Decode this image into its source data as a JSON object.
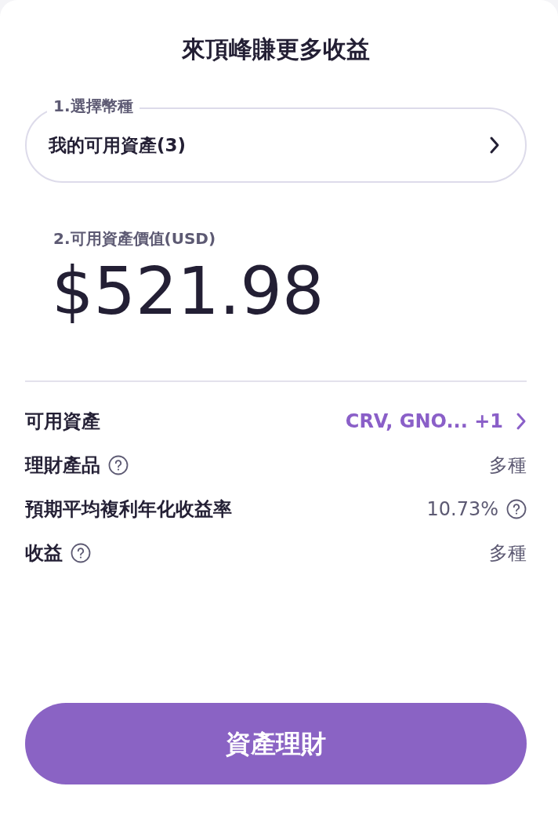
{
  "title": "來頂峰賺更多收益",
  "coin_select": {
    "legend": "1.選擇幣種",
    "value": "我的可用資產(3)"
  },
  "asset_value": {
    "label": "2.可用資產價值(USD)",
    "amount": "$521.98"
  },
  "rows": [
    {
      "label": "可用資產",
      "label_info": false,
      "kind": "link",
      "value": "CRV, GNO... +1",
      "value_info": false
    },
    {
      "label": "理財產品",
      "label_info": true,
      "kind": "plain",
      "value": "多種",
      "value_info": false
    },
    {
      "label": "預期平均複利年化收益率",
      "label_info": false,
      "kind": "plain",
      "value": "10.73%",
      "value_info": true
    },
    {
      "label": "收益",
      "label_info": true,
      "kind": "plain",
      "value": "多種",
      "value_info": false
    }
  ],
  "button": "資產理財"
}
